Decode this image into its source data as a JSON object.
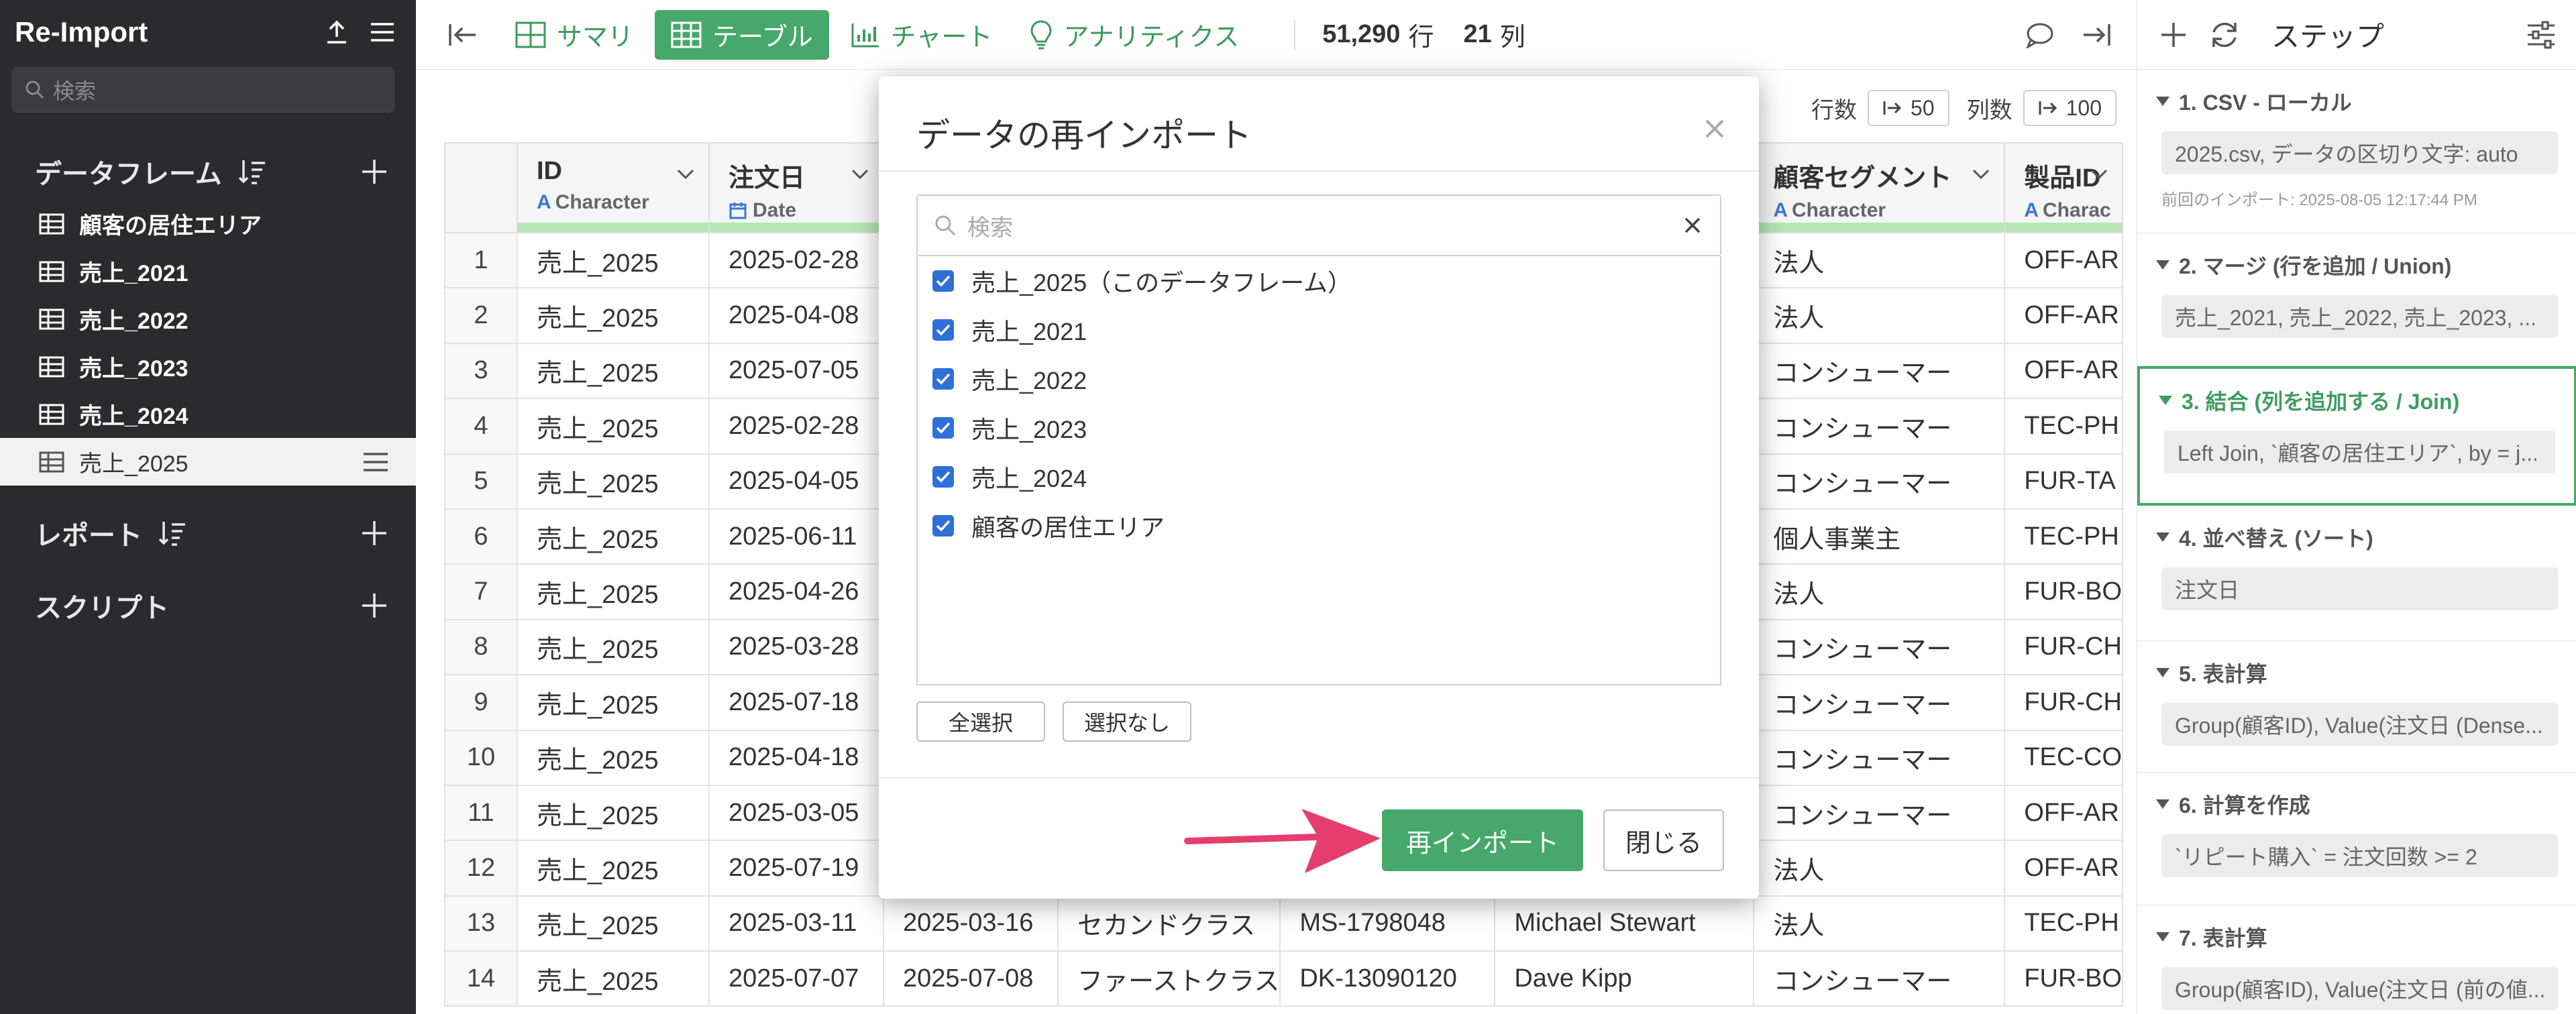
{
  "sidebar": {
    "title": "Re-Import",
    "search_placeholder": "検索",
    "sections": {
      "dataframes": "データフレーム",
      "reports": "レポート",
      "scripts": "スクリプト"
    },
    "dataframes": [
      {
        "label": "顧客の居住エリア",
        "active": false
      },
      {
        "label": "売上_2021",
        "active": false
      },
      {
        "label": "売上_2022",
        "active": false
      },
      {
        "label": "売上_2023",
        "active": false
      },
      {
        "label": "売上_2024",
        "active": false
      },
      {
        "label": "売上_2025",
        "active": true
      }
    ]
  },
  "toolbar": {
    "tabs": [
      {
        "label": "サマリ",
        "icon": "summary-icon"
      },
      {
        "label": "テーブル",
        "icon": "table-icon"
      },
      {
        "label": "チャート",
        "icon": "chart-icon"
      },
      {
        "label": "アナリティクス",
        "icon": "bulb-icon"
      }
    ],
    "active_tab": "テーブル",
    "row_count": "51,290",
    "row_unit": "行",
    "col_count": "21",
    "col_unit": "列"
  },
  "pager": {
    "rows_label": "行数",
    "rows_value": "50",
    "cols_label": "列数",
    "cols_value": "100"
  },
  "table": {
    "columns": [
      {
        "name": "ID",
        "type": "Character"
      },
      {
        "name": "注文日",
        "type": "Date"
      },
      {
        "name": "",
        "type": ""
      },
      {
        "name": "",
        "type": ""
      },
      {
        "name": "",
        "type": ""
      },
      {
        "name": "",
        "type": ""
      },
      {
        "name": "顧客セグメント",
        "type": "Character"
      },
      {
        "name": "製品ID",
        "type": "Charac"
      }
    ],
    "rows": [
      [
        "1",
        "売上_2025",
        "2025-02-28",
        "",
        "",
        "",
        "",
        "法人",
        "OFF-AR"
      ],
      [
        "2",
        "売上_2025",
        "2025-04-08",
        "",
        "",
        "",
        "",
        "法人",
        "OFF-AR"
      ],
      [
        "3",
        "売上_2025",
        "2025-07-05",
        "",
        "",
        "",
        "",
        "コンシューマー",
        "OFF-AR"
      ],
      [
        "4",
        "売上_2025",
        "2025-02-28",
        "",
        "",
        "",
        "",
        "コンシューマー",
        "TEC-PH"
      ],
      [
        "5",
        "売上_2025",
        "2025-04-05",
        "",
        "",
        "",
        "",
        "コンシューマー",
        "FUR-TA"
      ],
      [
        "6",
        "売上_2025",
        "2025-06-11",
        "",
        "",
        "",
        "",
        "個人事業主",
        "TEC-PH"
      ],
      [
        "7",
        "売上_2025",
        "2025-04-26",
        "",
        "",
        "",
        "",
        "法人",
        "FUR-BO"
      ],
      [
        "8",
        "売上_2025",
        "2025-03-28",
        "",
        "",
        "",
        "",
        "コンシューマー",
        "FUR-CH"
      ],
      [
        "9",
        "売上_2025",
        "2025-07-18",
        "",
        "",
        "",
        "",
        "コンシューマー",
        "FUR-CH"
      ],
      [
        "10",
        "売上_2025",
        "2025-04-18",
        "",
        "",
        "",
        "",
        "コンシューマー",
        "TEC-CO"
      ],
      [
        "11",
        "売上_2025",
        "2025-03-05",
        "",
        "",
        "",
        "",
        "コンシューマー",
        "OFF-AR"
      ],
      [
        "12",
        "売上_2025",
        "2025-07-19",
        "",
        "",
        "",
        "",
        "法人",
        "OFF-AR"
      ],
      [
        "13",
        "売上_2025",
        "2025-03-11",
        "2025-03-16",
        "セカンドクラス",
        "MS-1798048",
        "Michael Stewart",
        "法人",
        "TEC-PH"
      ],
      [
        "14",
        "売上_2025",
        "2025-07-07",
        "2025-07-08",
        "ファーストクラス",
        "DK-13090120",
        "Dave Kipp",
        "コンシューマー",
        "FUR-BO"
      ]
    ]
  },
  "steps": {
    "title": "ステップ",
    "items": [
      {
        "title": "1. CSV - ローカル",
        "body": "2025.csv, データの区切り文字: auto",
        "note": "前回のインポート: 2025-08-05 12:17:44 PM",
        "selected": false
      },
      {
        "title": "2. マージ (行を追加 / Union)",
        "body": "売上_2021, 売上_2022, 売上_2023, ...",
        "note": "",
        "selected": false
      },
      {
        "title": "3. 結合 (列を追加する / Join)",
        "body": "Left Join, `顧客の居住エリア`, by = j...",
        "note": "",
        "selected": true
      },
      {
        "title": "4. 並べ替え (ソート)",
        "body": "注文日",
        "note": "",
        "selected": false
      },
      {
        "title": "5. 表計算",
        "body": "Group(顧客ID), Value(注文日 (Dense...",
        "note": "",
        "selected": false
      },
      {
        "title": "6. 計算を作成",
        "body": "`リピート購入` = 注文回数 >= 2",
        "note": "",
        "selected": false
      },
      {
        "title": "7. 表計算",
        "body": "Group(顧客ID), Value(注文日 (前の値...",
        "note": "",
        "selected": false
      }
    ]
  },
  "modal": {
    "title": "データの再インポート",
    "search_placeholder": "検索",
    "items": [
      {
        "label": "売上_2025（このデータフレーム）",
        "checked": true
      },
      {
        "label": "売上_2021",
        "checked": true
      },
      {
        "label": "売上_2022",
        "checked": true
      },
      {
        "label": "売上_2023",
        "checked": true
      },
      {
        "label": "売上_2024",
        "checked": true
      },
      {
        "label": "顧客の居住エリア",
        "checked": true
      }
    ],
    "select_all": "全選択",
    "select_none": "選択なし",
    "primary": "再インポート",
    "close": "閉じる"
  },
  "colors": {
    "accent_green": "#46a86a",
    "arrow": "#e53e6e",
    "checkbox": "#2f6fd8",
    "sidebar_bg": "#2b2b2d"
  }
}
